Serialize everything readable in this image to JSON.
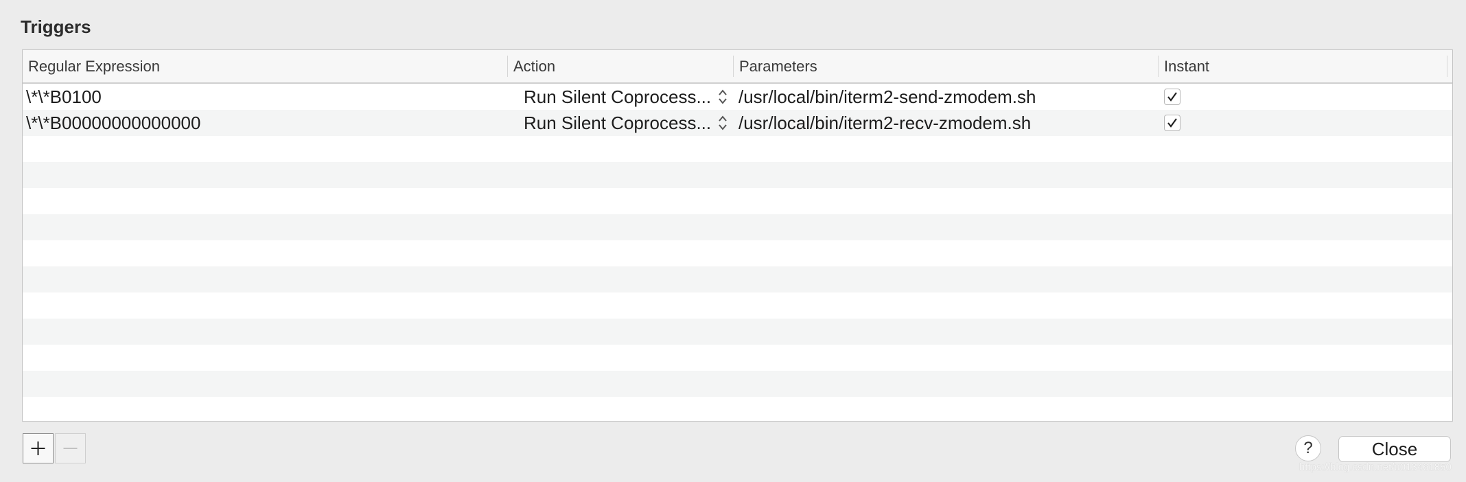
{
  "title": "Triggers",
  "table": {
    "columns": [
      "Regular Expression",
      "Action",
      "Parameters",
      "Instant"
    ],
    "rows": [
      {
        "regex": "\\*\\*B0100",
        "action": "Run Silent Coprocess...",
        "parameters": "/usr/local/bin/iterm2-send-zmodem.sh",
        "instant": true
      },
      {
        "regex": "\\*\\*B00000000000000",
        "action": "Run Silent Coprocess...",
        "parameters": "/usr/local/bin/iterm2-recv-zmodem.sh",
        "instant": true
      }
    ]
  },
  "buttons": {
    "add_icon": "plus-icon",
    "remove_icon": "minus-icon",
    "help": "?",
    "close": "Close"
  },
  "watermark": "https://blog.csdn.net/u013461850"
}
